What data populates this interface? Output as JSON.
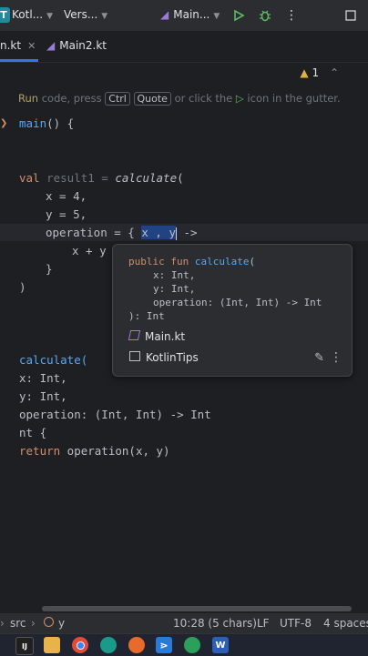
{
  "toolbar": {
    "project_initial": "T",
    "project_label": "Kotl...",
    "vcs_label": "Vers...",
    "run_config_label": "Main...",
    "colors": {
      "accent": "#3574f0",
      "run": "#5fb865"
    }
  },
  "tabs": [
    {
      "label": "n.kt",
      "active": true
    },
    {
      "label": "Main2.kt",
      "active": false
    }
  ],
  "editor": {
    "warning_count": "1",
    "hint": {
      "run": "Run",
      "code_press": " code, press ",
      "key1": "Ctrl",
      "key2": "Quote",
      "tail": " or click the ",
      "tail2": " icon in the gutter."
    },
    "lines": {
      "main_fn": "main",
      "main_rest": "() {",
      "val_kw": "val",
      "result1": " result1 = ",
      "calculate_call": "calculate",
      "open_paren": "(",
      "x_line": "x = 4,",
      "y_line": "y = 5,",
      "op_line_a": "operation = { ",
      "op_sel": "x , y",
      "op_line_b": " ->",
      "body_line": "x + y",
      "close_brace": "}",
      "close_paren": ")",
      "calc_decl": "calculate(",
      "param_x": "x: Int,",
      "param_y": "y: Int,",
      "param_op": "operation: (Int, Int) -> Int",
      "ret_line": "nt {",
      "return_kw": "return",
      "return_rest": " operation(x, y)"
    }
  },
  "popup": {
    "sig_kw": "public fun ",
    "sig_fn": "calculate",
    "sig_open": "(",
    "p1": "x: Int,",
    "p2": "y: Int,",
    "p3": "operation: (Int, Int) -> Int",
    "ret": "): Int",
    "file": "Main.kt",
    "project": "KotlinTips"
  },
  "status": {
    "src": "src",
    "symbol": "y",
    "position": "10:28 (5 chars)",
    "line_sep": "LF",
    "encoding": "UTF-8",
    "indent": "4 spaces"
  },
  "taskbar": {
    "word_letter": "W"
  }
}
